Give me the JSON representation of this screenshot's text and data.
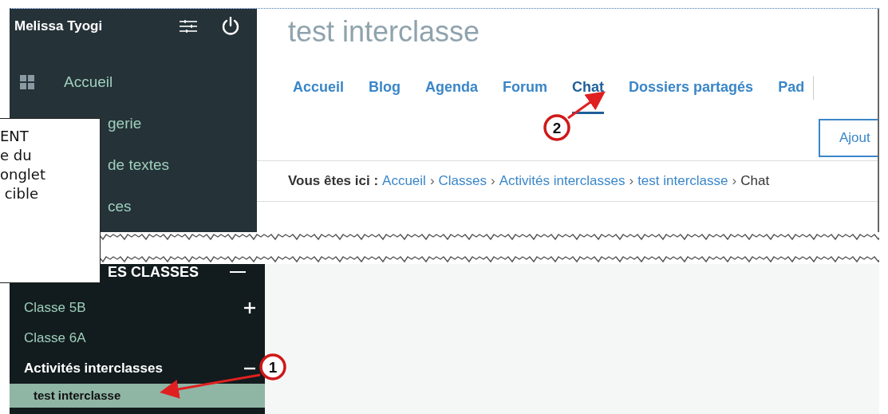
{
  "sidebar": {
    "user_name": "Melissa Tyogi",
    "items": [
      {
        "label": "Accueil",
        "kind": "icon"
      },
      {
        "label": "gerie",
        "kind": "clipped"
      },
      {
        "label": "de textes",
        "kind": "clipped"
      },
      {
        "label": "ces",
        "kind": "clipped"
      }
    ],
    "section": {
      "title": "ES CLASSES",
      "expanded": true,
      "items": [
        {
          "label": "Classe 5B",
          "kind": "group",
          "expanded": false,
          "selected": false
        },
        {
          "label": "Classe 6A",
          "kind": "leaf",
          "selected": false
        },
        {
          "label": "Activités interclasses",
          "kind": "group",
          "expanded": true,
          "selected": false,
          "children": [
            {
              "label": "test interclasse",
              "selected": true
            }
          ]
        }
      ]
    }
  },
  "note": {
    "text": "ENT\ne du\nonglet\n cible"
  },
  "main": {
    "title": "test interclasse",
    "tabs": [
      {
        "label": "Accueil",
        "selected": false
      },
      {
        "label": "Blog",
        "selected": false
      },
      {
        "label": "Agenda",
        "selected": false
      },
      {
        "label": "Forum",
        "selected": false
      },
      {
        "label": "Chat",
        "selected": true
      },
      {
        "label": "Dossiers partagés",
        "selected": false
      },
      {
        "label": "Pad",
        "selected": false
      }
    ],
    "button": "Ajout",
    "breadcrumb": {
      "label": "Vous êtes ici :",
      "separator": "›",
      "items": [
        {
          "text": "Accueil",
          "current": false
        },
        {
          "text": "Classes",
          "current": false
        },
        {
          "text": "Activités interclasses",
          "current": false
        },
        {
          "text": "test interclasse",
          "current": false
        },
        {
          "text": "Chat",
          "current": true
        }
      ]
    }
  },
  "annotations": [
    {
      "label": "1"
    },
    {
      "label": "2"
    }
  ]
}
